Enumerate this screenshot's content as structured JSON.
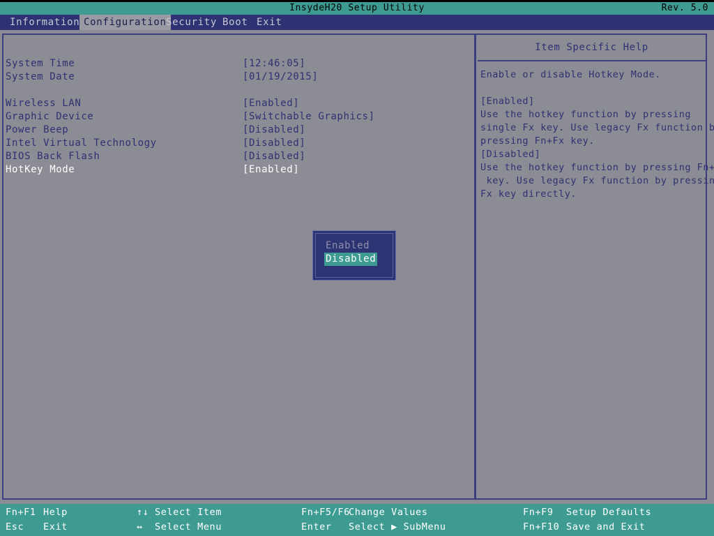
{
  "header": {
    "app_title": "InsydeH20 Setup Utility",
    "revision": "Rev. 5.0"
  },
  "menu": {
    "items": [
      {
        "label": "Information",
        "active": false
      },
      {
        "label": "Configuration",
        "active": true
      },
      {
        "label": "Security",
        "active": false
      },
      {
        "label": "Boot",
        "active": false
      },
      {
        "label": "Exit",
        "active": false
      }
    ]
  },
  "settings": {
    "rows": [
      {
        "label": "System Time",
        "value": "[12:46:05]",
        "selected": false
      },
      {
        "label": "System Date",
        "value": "[01/19/2015]",
        "selected": false
      },
      {
        "label": "",
        "value": "",
        "selected": false
      },
      {
        "label": "Wireless LAN",
        "value": "[Enabled]",
        "selected": false
      },
      {
        "label": "Graphic Device",
        "value": "[Switchable Graphics]",
        "selected": false
      },
      {
        "label": "Power Beep",
        "value": "[Disabled]",
        "selected": false
      },
      {
        "label": "Intel Virtual Technology",
        "value": "[Disabled]",
        "selected": false
      },
      {
        "label": "BIOS Back Flash",
        "value": "[Disabled]",
        "selected": false
      },
      {
        "label": "HotKey Mode",
        "value": "[Enabled]",
        "selected": true
      }
    ]
  },
  "help": {
    "title": "Item Specific Help",
    "lines": [
      "Enable or disable Hotkey Mode.",
      "",
      "[Enabled]",
      "Use the hotkey function by pressing",
      "single Fx key. Use legacy Fx function by",
      "pressing Fn+Fx key.",
      "[Disabled]",
      "Use the hotkey function by pressing Fn+Fx",
      " key. Use legacy Fx function by pressing",
      "Fx key directly."
    ]
  },
  "dropdown": {
    "options": [
      {
        "label": "Enabled",
        "selected": false
      },
      {
        "label": "Disabled",
        "selected": true
      }
    ]
  },
  "status_bar": {
    "entries": [
      {
        "key": "Fn+F1",
        "desc": "Help",
        "col": 0,
        "row": 0
      },
      {
        "key": "Esc",
        "desc": "Exit",
        "col": 0,
        "row": 1
      },
      {
        "key": "↑↓",
        "desc": "Select Item",
        "col": 1,
        "row": 0
      },
      {
        "key": "↔",
        "desc": "Select Menu",
        "col": 1,
        "row": 1
      },
      {
        "key": "Fn+F5/F6",
        "desc": "Change Values",
        "col": 2,
        "row": 0
      },
      {
        "key": "Enter",
        "desc": "Select ▶ SubMenu",
        "col": 2,
        "row": 1
      },
      {
        "key": "Fn+F9",
        "desc": "Setup Defaults",
        "col": 3,
        "row": 0
      },
      {
        "key": "Fn+F10",
        "desc": "Save and Exit",
        "col": 3,
        "row": 1
      }
    ]
  },
  "colors": {
    "teal": "#3d9b92",
    "menu_navy": "#2e3172",
    "panel_gray": "#8c8c94",
    "text_navy": "#2e3172",
    "selected_white": "#ffffff",
    "dropdown_bg": "#2d3473"
  }
}
